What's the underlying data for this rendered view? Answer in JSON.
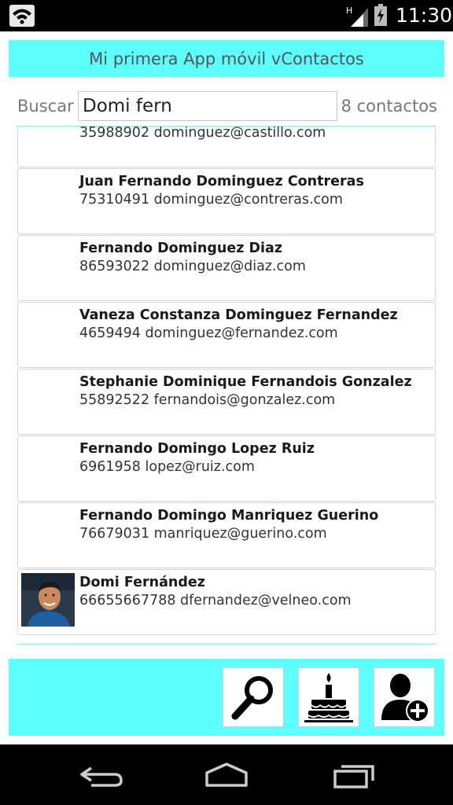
{
  "status_bar": {
    "time": "11:30",
    "network_label": "H",
    "icons": [
      "wifi-icon",
      "signal-icon",
      "battery-icon"
    ]
  },
  "app": {
    "title": "Mi primera App móvil vContactos"
  },
  "search": {
    "label": "Buscar",
    "value": "Domi fern",
    "count_text": "8 contactos"
  },
  "contacts": [
    {
      "name": "",
      "info": "35988902 dominguez@castillo.com"
    },
    {
      "name": "Juan Fernando Dominguez Contreras",
      "info": "75310491 dominguez@contreras.com"
    },
    {
      "name": "Fernando Dominguez Diaz",
      "info": "86593022 dominguez@diaz.com"
    },
    {
      "name": "Vaneza Constanza Dominguez Fernandez",
      "info": "4659494 dominguez@fernandez.com"
    },
    {
      "name": "Stephanie Dominique Fernandois Gonzalez",
      "info": "55892522 fernandois@gonzalez.com"
    },
    {
      "name": "Fernando Domingo Lopez Ruiz",
      "info": "6961958 lopez@ruiz.com"
    },
    {
      "name": "Fernando Domingo Manriquez Guerino",
      "info": "76679031 manriquez@guerino.com"
    },
    {
      "name": "Domi Fernández",
      "info": "66655667788 dfernandez@velneo.com",
      "has_photo": true
    }
  ],
  "toolbar": {
    "buttons": [
      "search-icon",
      "birthday-cake-icon",
      "add-contact-icon"
    ]
  },
  "navigation": {
    "buttons": [
      "back-icon",
      "home-icon",
      "recent-apps-icon"
    ]
  },
  "colors": {
    "accent": "#5effff",
    "status_bar": "#000000",
    "title_text": "#555555"
  }
}
